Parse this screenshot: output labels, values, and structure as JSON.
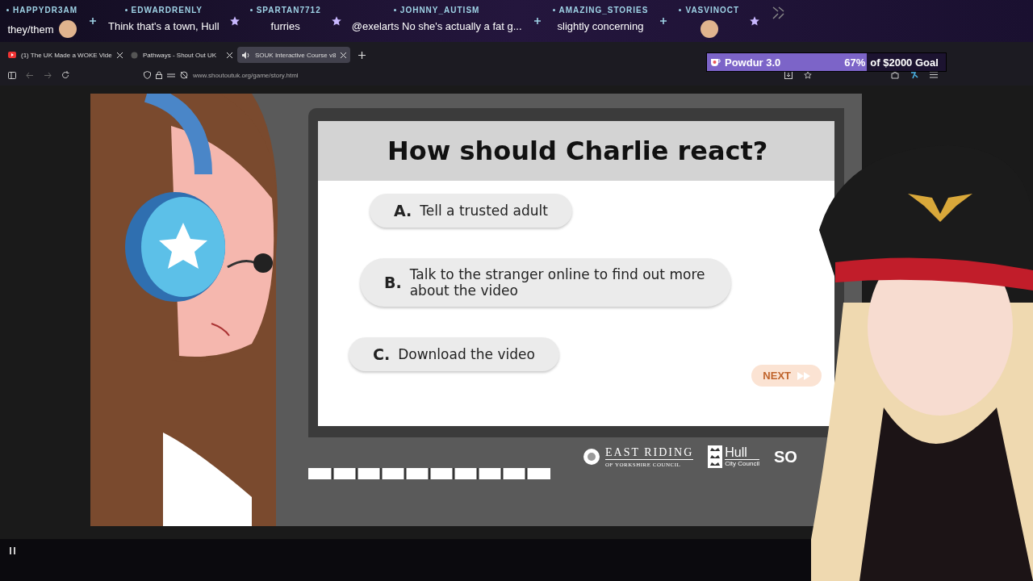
{
  "chat": [
    {
      "user": "HAPPYDR3AM",
      "text": "they/them",
      "emote": true,
      "kind": "plus"
    },
    {
      "user": "EDWARDRENLY",
      "text": "Think that's a town, Hull",
      "emote": false,
      "kind": "star"
    },
    {
      "user": "SPARTAN7712",
      "text": "furries",
      "emote": false,
      "kind": "star"
    },
    {
      "user": "JOHNNY_AUTISM",
      "text": "@exelarts No she's actually a fat g...",
      "emote": false,
      "kind": "plus"
    },
    {
      "user": "AMAZING_STORIES",
      "text": "slightly concerning",
      "emote": false,
      "kind": "plus"
    },
    {
      "user": "VASVINOCT",
      "emote": true,
      "kind": "star"
    }
  ],
  "tabs": [
    {
      "title": "(1) The UK Made a WOKE Vide",
      "kind": "video",
      "selected": false
    },
    {
      "title": "Pathways - Shout Out UK",
      "kind": "site",
      "selected": false
    },
    {
      "title": "SOUK Interactive Course v8",
      "kind": "audio",
      "selected": true
    }
  ],
  "url": "www.shoutoutuk.org/game/story.html",
  "goal": {
    "name": "Powdur 3.0",
    "percent": "67%",
    "text": "of $2000 Goal",
    "level": 0.67
  },
  "question": {
    "title": "How should Charlie react?",
    "options": [
      {
        "letter": "A.",
        "text": "Tell a trusted adult"
      },
      {
        "letter": "B.",
        "text": "Talk to the stranger online to find out more about the video"
      },
      {
        "letter": "C.",
        "text": "Download the video"
      }
    ],
    "next": {
      "label": "NEXT",
      "disabled": true
    }
  },
  "logos": {
    "east_riding": "EAST RIDING",
    "east_riding_sub": "OF YORKSHIRE COUNCIL",
    "hull": "Hull",
    "hull_sub": "City Council",
    "souk": "SO"
  }
}
